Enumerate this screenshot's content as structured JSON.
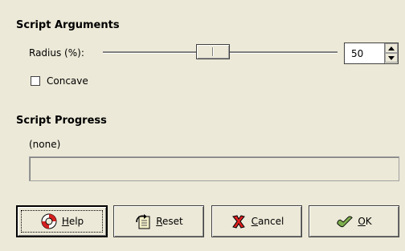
{
  "script_arguments": {
    "title": "Script Arguments",
    "radius_label": "Radius (%):",
    "radius_value": "50",
    "radius_slider_fraction": 0.5,
    "concave_label": "Concave",
    "concave_checked": false
  },
  "script_progress": {
    "title": "Script Progress",
    "status": "(none)",
    "progress_fraction": 0
  },
  "buttons": {
    "help_prefix": "",
    "help_accel": "H",
    "help_rest": "elp",
    "reset_accel": "R",
    "reset_rest": "eset",
    "cancel_accel": "C",
    "cancel_rest": "ancel",
    "ok_accel": "O",
    "ok_rest": "K"
  },
  "icons": {
    "help": "lifebuoy-icon",
    "reset": "reset-icon",
    "cancel": "cancel-x-icon",
    "ok": "ok-check-icon",
    "spin_up": "triangle-up-icon",
    "spin_down": "triangle-down-icon"
  }
}
